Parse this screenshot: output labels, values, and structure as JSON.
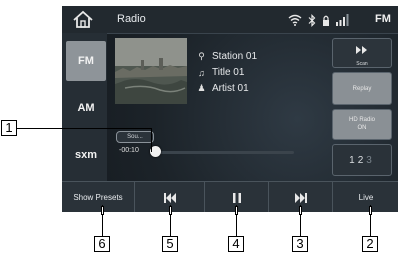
{
  "statusbar": {
    "title": "Radio",
    "band_indicator": "FM",
    "icons": [
      "home-icon",
      "wifi-icon",
      "bluetooth-icon",
      "lock-icon",
      "signal-icon"
    ]
  },
  "bands": [
    {
      "label": "FM",
      "active": true
    },
    {
      "label": "AM",
      "active": false
    },
    {
      "label": "sxm",
      "active": false
    }
  ],
  "now_playing": {
    "station": "Station 01",
    "title": "Title 01",
    "artist": "Artist 01"
  },
  "source_label": "Sou...",
  "time": "-00:10",
  "progress": 0.0,
  "right_panel": {
    "scan": "Scan",
    "replay": "Replay",
    "hd_radio": "HD Radio",
    "hd_status": "ON",
    "preset_active": "1",
    "preset_inactive": "2",
    "preset_dim": "3"
  },
  "bottom": {
    "show_presets": "Show Presets",
    "live": "Live"
  },
  "callouts": [
    "1",
    "2",
    "3",
    "4",
    "5",
    "6"
  ],
  "colors": {
    "background": "#1b2127",
    "active_band": "#8e9499"
  }
}
